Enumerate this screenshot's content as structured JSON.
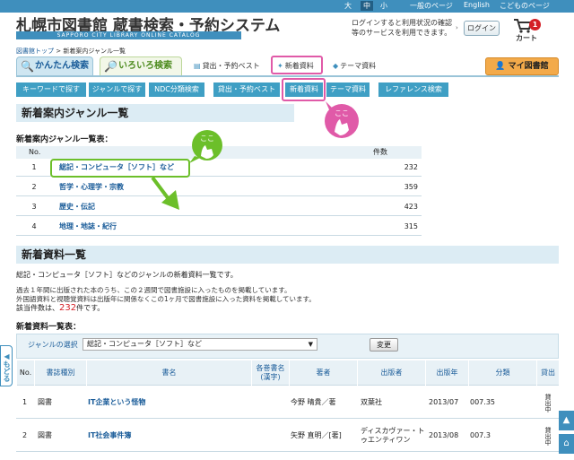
{
  "topbar": {
    "size_large": "大",
    "size_medium": "中",
    "size_small": "小",
    "general_page": "一般のページ",
    "english": "English",
    "kids_page": "こどものページ"
  },
  "header": {
    "title": "札幌市図書館 蔵書検索・予約システム",
    "subtitle": "SAPPORO CITY LIBRARY ONLINE CATALOG",
    "login_message": "ログインすると利用状況の確認等のサービスを利用できます。",
    "login_button": "ログイン",
    "cart_label": "カート",
    "cart_count": "1"
  },
  "breadcrumb": {
    "home": "図書館トップ",
    "separator": ">",
    "current": "新着案内ジャンル一覧"
  },
  "tabs": {
    "simple_search": "かんたん検索",
    "various_search": "いろいろ検索",
    "best_link": "貸出・予約ベスト",
    "new_link": "新着資料",
    "theme_link": "テーマ資料",
    "mypage": "マイ図書館"
  },
  "subnav": {
    "keyword": "キーワードで探す",
    "genre": "ジャンルで探す",
    "ndc": "NDC分類検索",
    "best": "貸出・予約ベスト",
    "new": "新着資料",
    "theme": "テーマ資料",
    "reference": "レファレンス検索"
  },
  "annotations": {
    "tap_here": "ここ"
  },
  "genre_section": {
    "heading": "新着案内ジャンル一覧",
    "list_title": "新着案内ジャンル一覧表：",
    "col_no": "No.",
    "col_count": "件数",
    "rows": [
      {
        "no": "1",
        "genre": "総記・コンピュータ［ソフト］など",
        "count": "232"
      },
      {
        "no": "2",
        "genre": "哲学・心理学・宗教",
        "count": "359"
      },
      {
        "no": "3",
        "genre": "歴史・伝記",
        "count": "423"
      },
      {
        "no": "4",
        "genre": "地理・地誌・紀行",
        "count": "315"
      }
    ]
  },
  "new_section": {
    "heading": "新着資料一覧",
    "desc_genre": "総記・コンピュータ［ソフト］など",
    "desc_suffix": "のジャンルの新着資料一覧です。",
    "note1": "過去１年間に出版された本のうち、この２週間で図書施設に入ったものを掲載しています。",
    "note2": "外国語資料と視聴覚資料は出版年に関係なくこの1ヶ月で図書施設に入った資料を掲載しています。",
    "count_prefix": "該当件数は、",
    "count_value": "232",
    "count_suffix": "件です。",
    "list_title": "新着資料一覧表：",
    "genre_select_label": "ジャンルの選択",
    "genre_select_value": "総記・コンピュータ［ソフト］など",
    "change_button": "変更",
    "columns": {
      "no": "No.",
      "type": "書誌種別",
      "title": "書名",
      "volume": "各巻書名(漢字)",
      "author": "著者",
      "publisher": "出版者",
      "year": "出版年",
      "class": "分類",
      "lend": "貸出"
    },
    "rows": [
      {
        "no": "1",
        "type": "図書",
        "title": "IT企業という怪物",
        "volume": "",
        "author": "今野 晴貴／著",
        "publisher": "双葉社",
        "year": "2013/07",
        "class": "007.35",
        "status": "貸出中"
      },
      {
        "no": "2",
        "type": "図書",
        "title": "IT社会事件簿",
        "volume": "",
        "author": "矢野 直明／[著]",
        "publisher": "ディスカヴァー・トゥエンティワン",
        "year": "2013/08",
        "class": "007.3",
        "status": "貸出中"
      }
    ]
  },
  "side": {
    "back_button": "もどる"
  },
  "colors": {
    "accent": "#3f8fbd",
    "highlight_green": "#6cbf2a",
    "highlight_magenta": "#e05aa8",
    "count_red": "#d41f26"
  }
}
